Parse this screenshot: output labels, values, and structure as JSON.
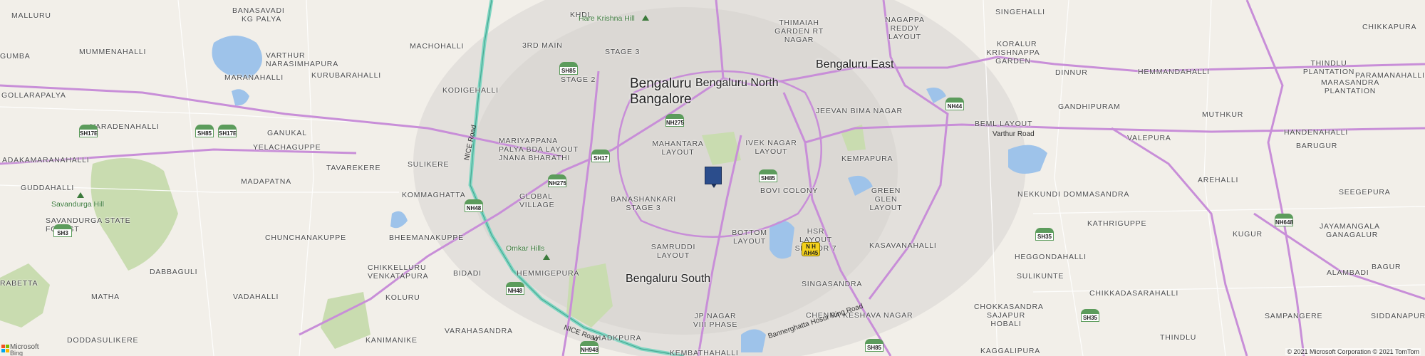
{
  "map": {
    "cities": {
      "bengaluru": "Bengaluru",
      "bangalore": "Bangalore",
      "north": "Bengaluru North",
      "east": "Bengaluru East",
      "south": "Bengaluru South"
    },
    "localities": [
      "Malluru",
      "Banasavadi",
      "KG Palya",
      "Machohalli",
      "Varthur Narasimhapura",
      "Mummenahalli",
      "Gumba",
      "Maranahalli",
      "Kurubarahalli",
      "Kodigehalli",
      "Gollarapalya",
      "Varadenahalli",
      "Ganukal",
      "Yelachaguppe",
      "Adakamaranahalli",
      "Sulikere",
      "Tavarekere",
      "Guddahalli",
      "Madapatna",
      "Kommaghatta",
      "Global Village",
      "Chunchanakuppe",
      "Bheemanakuppe",
      "Savandurga State Forest",
      "Chikkelluru Venkatapura",
      "Hemmigepura",
      "Bidadi",
      "Dabbaguli",
      "Vadahalli",
      "Koluru",
      "Matha",
      "Varahasandra",
      "Kanimanike",
      "Doddasulikere",
      "Rabetta",
      "Ihadkpura",
      "Kembathahalli",
      "JP Nagar VIII Phase",
      "Samruddi Layout",
      "Bottom Layout",
      "Banashankari Stage 3",
      "Mariyappana Palya BDA Layout Jnana Bharathi",
      "Mahantara Layout",
      "Stage 2",
      "Stage 3",
      "3rd Main",
      "Khdl",
      "Thimaiah Garden RT Nagar",
      "Nagappa Reddy Layout",
      "Singehalli",
      "Koralur",
      "Krishnappa Garden",
      "Dinnur",
      "Jeevan Bima Nagar",
      "BEML Layout",
      "Gandhipuram",
      "Ivek Nagar Layout",
      "Bovi Colony",
      "Kempapura",
      "Green Glen Layout",
      "HSR Layout Sector 7",
      "Kasavanahalli",
      "Singasandra",
      "Chenna Keshava Nagar",
      "Chokkasandra Sajapur Hobali",
      "Kaggalipura",
      "Sulikunte",
      "Heggondahalli",
      "Kathriguppe",
      "Nekkundi Dommasandra",
      "Chikkadasarahalli",
      "Valepura",
      "Muthkur",
      "Arehalli",
      "Kugur",
      "Paramanahalli",
      "Chikkapura",
      "Thindlu Plantation",
      "Marasandra Plantation",
      "Hemmandahalli",
      "Handenahalli",
      "Barugur",
      "Seegepura",
      "Jayamangala",
      "Ganagalur",
      "Bagur",
      "Alambadi",
      "Siddanapura",
      "Sampangere",
      "Thindlu",
      "Chokkasandra",
      "Hobali",
      "Sajapur",
      "Gollarapalya"
    ],
    "pois": {
      "hare_krishna_hill": "Hare Krishna Hill",
      "savandurga_hill": "Savandurga Hill",
      "omkar_hills": "Omkar Hills"
    },
    "roads": {
      "nice_road_1": "NICE Road",
      "nice_road_2": "NICE Road",
      "varthur_road": "Varthur Road",
      "bannerghatta": "Bannerghatta Hosur Ring Road"
    },
    "shields": [
      "SH85",
      "SH85",
      "SH17E",
      "SH17E",
      "SH17",
      "NH275",
      "NH275",
      "NH48",
      "NH48",
      "NH948",
      "SH3",
      "NH44",
      "SH85",
      "SH35",
      "SH35",
      "NH648",
      "SH85"
    ],
    "ah_shield": {
      "line1": "N H",
      "line2": "AH45"
    },
    "attribution": "© 2021 Microsoft Corporation © 2021 TomTom",
    "logo": {
      "line1": "Microsoft",
      "line2": "Bing"
    }
  },
  "colors": {
    "land": "#f2efe9",
    "water": "#9ec3ea",
    "park": "#c9dcb0",
    "urban": "#dddad6",
    "highway": "#c88ed8",
    "ring": "#7fd6c2",
    "pin": "#2b4d8c"
  }
}
